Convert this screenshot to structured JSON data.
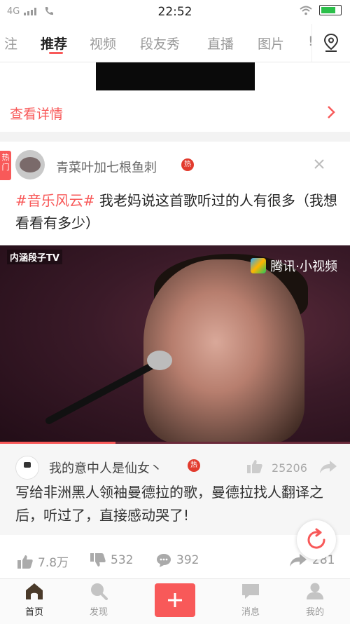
{
  "status_bar": {
    "network": "4G",
    "time": "22:52"
  },
  "tabs": [
    "注",
    "推荐",
    "视频",
    "段友秀",
    "直播",
    "图片",
    "!"
  ],
  "active_tab": "推荐",
  "detail_link": "查看详情",
  "post": {
    "hot_label": "热门",
    "username": "青菜叶加七根鱼刺",
    "hot_badge": "热",
    "hashtag": "#音乐风云#",
    "title": " 我老妈说这首歌听过的人有很多（我想看看有多少）",
    "video": {
      "watermark_left": "内涵段子TV",
      "watermark_right": "腾讯·小视频",
      "progress": 0.33
    },
    "top_comment": {
      "username": "我的意中人是仙女丶",
      "hot_badge": "热",
      "likes": "25206",
      "text": "写给非洲黑人领袖曼德拉的歌，曼德拉找人翻译之后，听过了，直接感动哭了!"
    },
    "actions": {
      "likes": "7.8万",
      "dislikes": "532",
      "comments": "392",
      "shares": "281"
    }
  },
  "bottom_nav": [
    {
      "label": "首页",
      "icon": "home-icon"
    },
    {
      "label": "发现",
      "icon": "discover-icon"
    },
    {
      "label": "",
      "icon": "plus-icon"
    },
    {
      "label": "消息",
      "icon": "message-icon"
    },
    {
      "label": "我的",
      "icon": "profile-icon"
    }
  ],
  "colors": {
    "accent": "#f85959",
    "muted": "#999999"
  }
}
